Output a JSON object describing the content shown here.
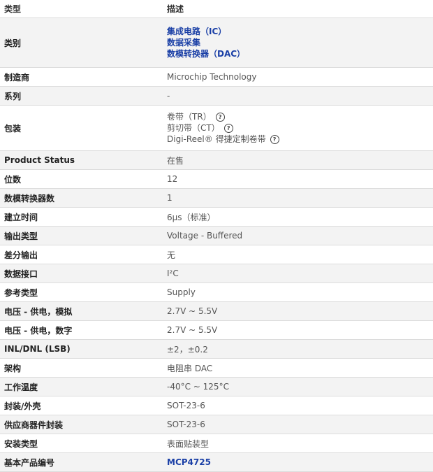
{
  "header": {
    "type_label": "类型",
    "desc_label": "描述"
  },
  "rows": {
    "category": {
      "label": "类别",
      "links": [
        "集成电路（IC）",
        "数据采集",
        "数模转换器（DAC）"
      ]
    },
    "manufacturer": {
      "label": "制造商",
      "value": "Microchip Technology"
    },
    "series": {
      "label": "系列",
      "value": "-"
    },
    "packaging": {
      "label": "包装",
      "options": [
        "卷带（TR）",
        "剪切带（CT）",
        "Digi-Reel® 得捷定制卷带"
      ],
      "help_icon": "question-circle-icon"
    },
    "product_status": {
      "label": "Product Status",
      "value": "在售"
    },
    "bits": {
      "label": "位数",
      "value": "12"
    },
    "dac_count": {
      "label": "数模转换器数",
      "value": "1"
    },
    "settling_time": {
      "label": "建立时间",
      "value": "6µs（标准）"
    },
    "output_type": {
      "label": "输出类型",
      "value": "Voltage - Buffered"
    },
    "differential_output": {
      "label": "差分输出",
      "value": "无"
    },
    "data_interface": {
      "label": "数据接口",
      "value": "I²C"
    },
    "reference_type": {
      "label": "参考类型",
      "value": "Supply"
    },
    "supply_analog": {
      "label": "电压 - 供电，模拟",
      "value": "2.7V ~ 5.5V"
    },
    "supply_digital": {
      "label": "电压 - 供电，数字",
      "value": "2.7V ~ 5.5V"
    },
    "inl_dnl": {
      "label": "INL/DNL (LSB)",
      "value": "±2，±0.2"
    },
    "architecture": {
      "label": "架构",
      "value": "电阻串 DAC"
    },
    "operating_temp": {
      "label": "工作温度",
      "value": "-40°C ~ 125°C"
    },
    "package_case": {
      "label": "封装/外壳",
      "value": "SOT-23-6"
    },
    "supplier_package": {
      "label": "供应商器件封装",
      "value": "SOT-23-6"
    },
    "mounting_type": {
      "label": "安装类型",
      "value": "表面贴装型"
    },
    "base_part": {
      "label": "基本产品编号",
      "value": "MCP4725"
    }
  },
  "colors": {
    "link": "#1a3fa6",
    "stripe": "#f3f3f3",
    "border": "#dcdcdc"
  }
}
